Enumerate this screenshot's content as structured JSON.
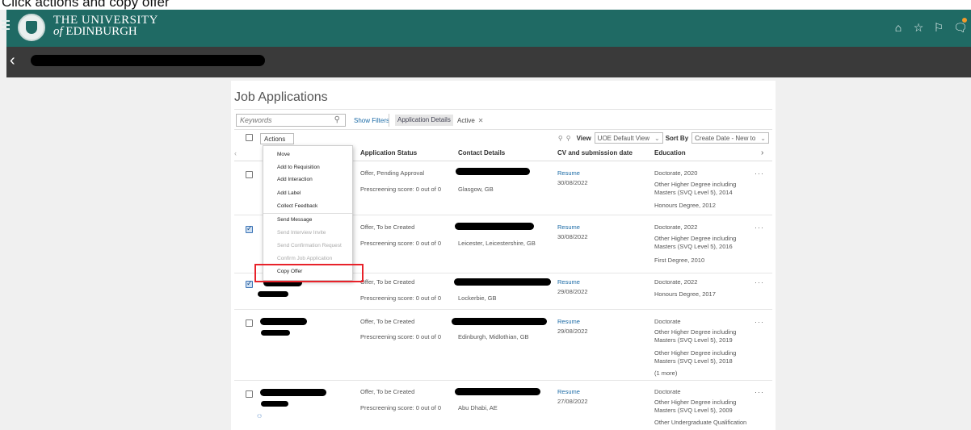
{
  "caption": "Click actions and copy offer",
  "header": {
    "brand_line1": "THE UNIVERSITY",
    "brand_line2_prefix": "of",
    "brand_line2_rest": "EDINBURGH",
    "icons": [
      "home-icon",
      "star-icon",
      "flag-icon",
      "notifications-icon"
    ],
    "colors": {
      "header_bg": "#1f6a64",
      "subbar_bg": "#3a3a3a",
      "badge": "#f29b2b"
    }
  },
  "page": {
    "title": "Job Applications",
    "search_placeholder": "Keywords",
    "show_filters": "Show Filters",
    "filter_chip": "Application Details",
    "active_chip": "Active",
    "actions_label": "Actions",
    "view_label": "View",
    "view_value": "UOE Default View",
    "sort_label": "Sort By",
    "sort_value": "Create Date - New to"
  },
  "columns": [
    "Application Status",
    "Contact Details",
    "CV and submission date",
    "Education"
  ],
  "actions_menu": {
    "items": [
      {
        "label": "Move",
        "enabled": true
      },
      {
        "label": "Add to Requisition",
        "enabled": true
      },
      {
        "label": "Add Interaction",
        "enabled": true
      },
      {
        "label": "Add Label",
        "enabled": true
      },
      {
        "label": "Collect Feedback",
        "enabled": true
      },
      {
        "label": "Send Message",
        "enabled": true
      },
      {
        "label": "Send Interview Invite",
        "enabled": false
      },
      {
        "label": "Send Confirmation Request",
        "enabled": false
      },
      {
        "label": "Confirm Job Application",
        "enabled": false
      },
      {
        "label": "Copy Offer",
        "enabled": true
      }
    ],
    "highlighted": "Copy Offer",
    "highlight_color": "#e8222a"
  },
  "rows": [
    {
      "checked": false,
      "status": "Offer, Pending Approval",
      "prescreening": "Prescreening score: 0 out of 0",
      "location": "Glasgow, GB",
      "cv": "Resume",
      "date": "30/08/2022",
      "education": [
        "Doctorate, 2020",
        "Other Higher Degree including Masters (SVQ Level 5), 2014",
        "Honours Degree, 2012"
      ]
    },
    {
      "checked": true,
      "status": "Offer, To be Created",
      "prescreening": "Prescreening score: 0 out of 0",
      "location": "Leicester, Leicestershire, GB",
      "cv": "Resume",
      "date": "30/08/2022",
      "education": [
        "Doctorate, 2022",
        "Other Higher Degree including Masters (SVQ Level 5), 2016",
        "First Degree, 2010"
      ]
    },
    {
      "checked": true,
      "status": "Offer, To be Created",
      "prescreening": "Prescreening score: 0 out of 0",
      "location": "Lockerbie, GB",
      "cv": "Resume",
      "date": "29/08/2022",
      "education": [
        "Doctorate, 2022",
        "Honours Degree, 2017"
      ]
    },
    {
      "checked": false,
      "status": "Offer, To be Created",
      "prescreening": "Prescreening score: 0 out of 0",
      "location": "Edinburgh, Midlothian, GB",
      "cv": "Resume",
      "date": "29/08/2022",
      "education": [
        "Doctorate",
        "Other Higher Degree including Masters (SVQ Level 5), 2019",
        "Other Higher Degree including Masters (SVQ Level 5), 2018",
        "(1 more)"
      ]
    },
    {
      "checked": false,
      "status": "Offer, To be Created",
      "prescreening": "Prescreening score: 0 out of 0",
      "location": "Abu Dhabi, AE",
      "cv": "Resume",
      "date": "27/08/2022",
      "education": [
        "Doctorate",
        "Other Higher Degree including Masters (SVQ Level 5), 2009",
        "Other Undergraduate Qualification"
      ]
    }
  ]
}
